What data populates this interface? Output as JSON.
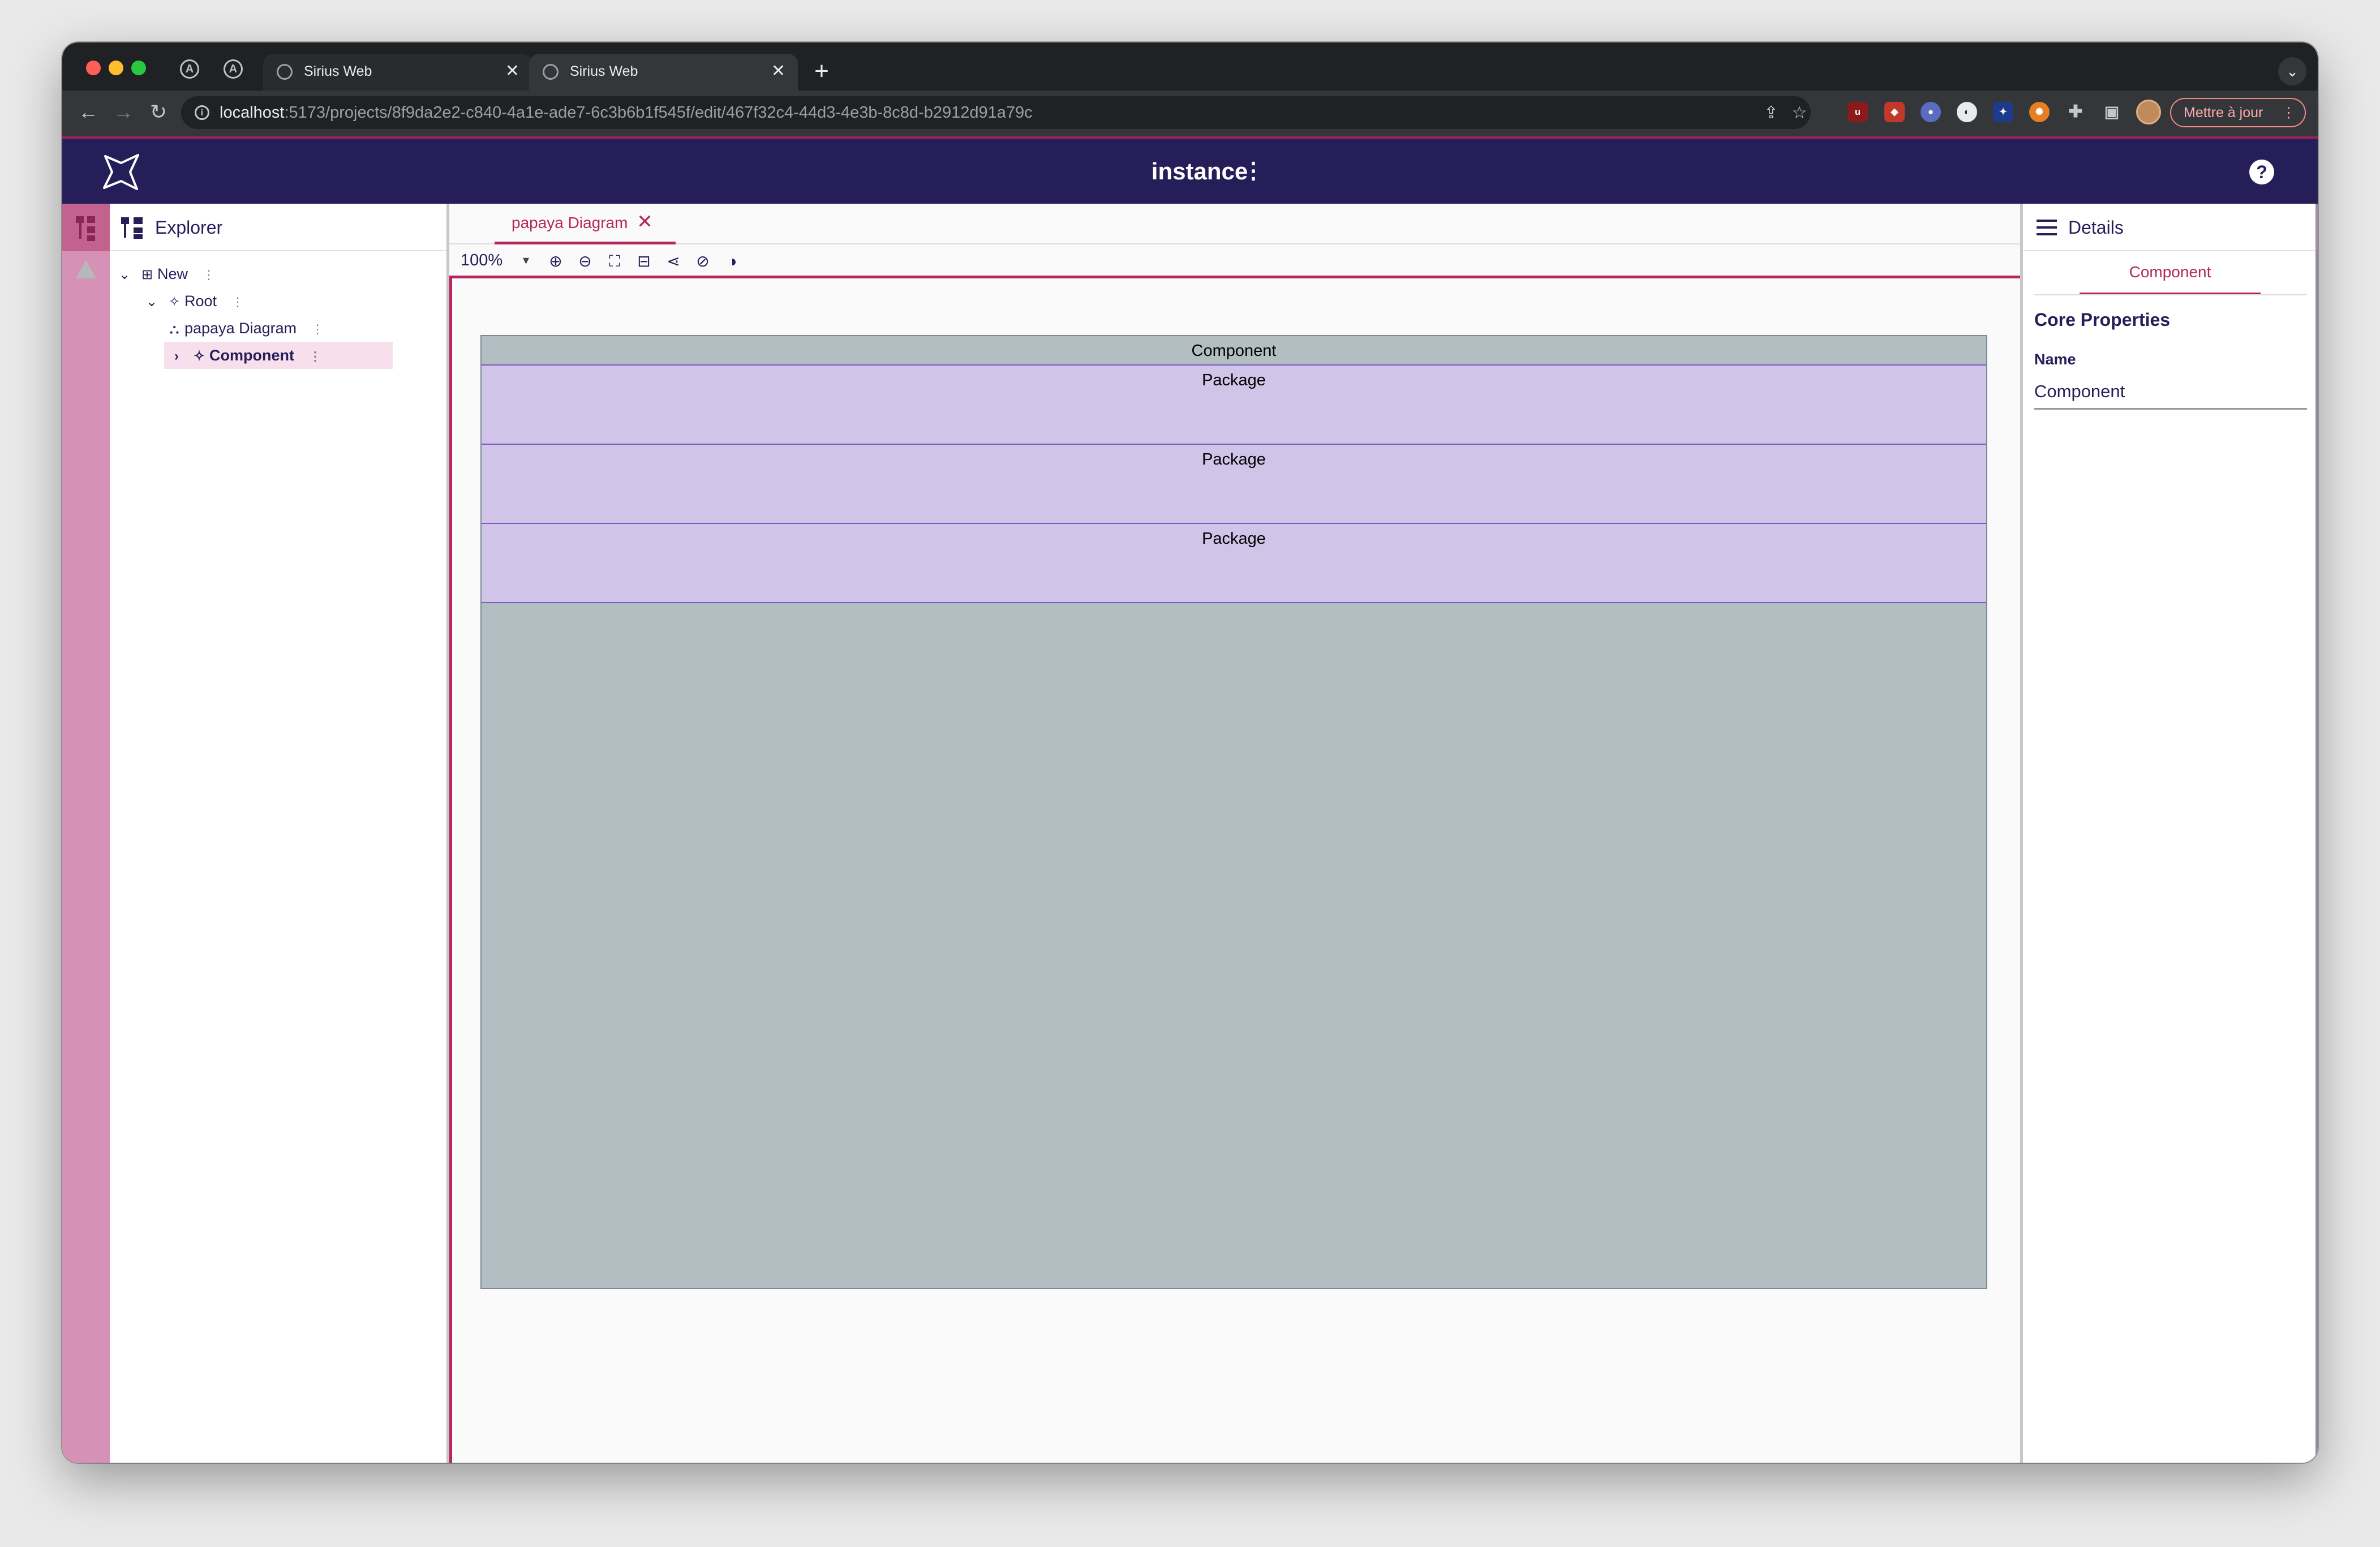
{
  "browser": {
    "tabs": [
      {
        "title": "Sirius Web",
        "close": "✕"
      },
      {
        "title": "Sirius Web",
        "close": "✕"
      }
    ],
    "pinned_tab_glyph": "A",
    "new_tab": "+",
    "tab_menu": "⌄",
    "url_host": "localhost",
    "url_path": ":5173/projects/8f9da2e2-c840-4a1e-ade7-6c3b6b1f545f/edit/467f32c4-44d3-4e3b-8c8d-b2912d91a79c",
    "update_button": "Mettre à jour",
    "update_menu": "⋮"
  },
  "app": {
    "title": "instance",
    "title_menu": "⋮",
    "help": "?",
    "accent_color": "#b5265f",
    "header_color": "#261e58"
  },
  "explorer": {
    "title": "Explorer",
    "tree": [
      {
        "label": "New",
        "chevron": "⌄",
        "icon": "project-icon"
      },
      {
        "label": "Root",
        "chevron": "⌄",
        "icon": "root-icon"
      },
      {
        "label": "papaya Diagram",
        "chevron": "",
        "icon": "diagram-icon"
      },
      {
        "label": "Component",
        "chevron": "›",
        "icon": "component-icon",
        "selected": true
      }
    ],
    "more": "⋮"
  },
  "editor": {
    "tab_label": "papaya Diagram",
    "tab_close": "✕",
    "zoom": "100%",
    "zoom_caret": "▾",
    "diagram": {
      "component_label": "Component",
      "packages": [
        "Package",
        "Package",
        "Package"
      ]
    }
  },
  "details": {
    "title": "Details",
    "tab": "Component",
    "section": "Core Properties",
    "name_label": "Name",
    "name_value": "Component"
  }
}
